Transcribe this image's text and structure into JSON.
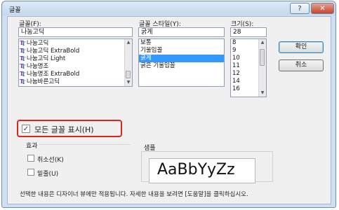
{
  "window": {
    "title": "글꼴",
    "help_glyph": "?",
    "close_glyph": "✕"
  },
  "font": {
    "label": "글꼴(F):",
    "value": "나눔고딕",
    "items": [
      {
        "name": "나눔고딕",
        "selected": false
      },
      {
        "name": "나눔고딕 ExtraBold",
        "selected": false
      },
      {
        "name": "나눔고딕 Light",
        "selected": false
      },
      {
        "name": "나눔명조",
        "selected": false
      },
      {
        "name": "나눔명조 ExtraBold",
        "selected": false
      },
      {
        "name": "나눔바른고딕",
        "selected": false
      }
    ]
  },
  "style": {
    "label": "글꼴 스타일(Y):",
    "value": "굵게",
    "items": [
      {
        "name": "보통",
        "selected": false
      },
      {
        "name": "기울임꼴",
        "selected": false
      },
      {
        "name": "굵게",
        "selected": true
      },
      {
        "name": "굵은 기울임꼴",
        "selected": false
      }
    ]
  },
  "size": {
    "label": "크기(S):",
    "value": "28",
    "items": [
      {
        "name": "8",
        "selected": false
      },
      {
        "name": "9",
        "selected": false
      },
      {
        "name": "10",
        "selected": false
      },
      {
        "name": "11",
        "selected": false
      },
      {
        "name": "12",
        "selected": false
      },
      {
        "name": "14",
        "selected": false
      },
      {
        "name": "16",
        "selected": false
      }
    ]
  },
  "buttons": {
    "ok": "확인",
    "cancel": "취소"
  },
  "show_all": {
    "label": "모든 글꼴 표시(H)",
    "checked": true,
    "check_glyph": "✓"
  },
  "effects": {
    "label": "효과",
    "strikeout": {
      "label": "취소선(K)",
      "checked": false
    },
    "underline": {
      "label": "밑줄(U)",
      "checked": false
    }
  },
  "sample": {
    "label": "샘플",
    "text": "AaBbYyZz"
  },
  "footer": "선택한 내용은 디자이너 뷰에만 적용됩니다. 자세한 내용을 보려면 [도움말]을 클릭하십시오.",
  "colors": {
    "highlight_border": "#e2231a",
    "selection": "#3399ff"
  }
}
